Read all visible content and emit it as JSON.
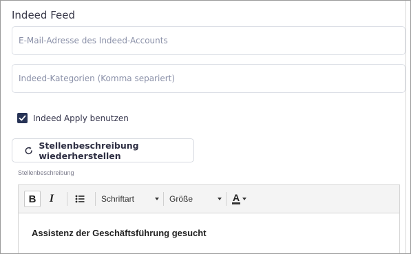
{
  "section": {
    "title": "Indeed Feed"
  },
  "fields": {
    "email_placeholder": "E-Mail-Adresse des Indeed-Accounts",
    "categories_placeholder": "Indeed-Kategorien (Komma separiert)"
  },
  "apply_checkbox": {
    "label": "Indeed Apply benutzen",
    "checked": true,
    "color": "#273356"
  },
  "restore_button": {
    "label": "Stellenbeschreibung wiederherstellen",
    "icon": "refresh-icon"
  },
  "editor": {
    "label": "Stellenbeschreibung",
    "toolbar": {
      "bold": "B",
      "italic": "I",
      "list_icon": "bullet-list-icon",
      "font_dropdown": "Schriftart",
      "size_dropdown": "Größe",
      "color_button": "A"
    },
    "content_heading": "Assistenz der Geschäftsführung gesucht"
  }
}
